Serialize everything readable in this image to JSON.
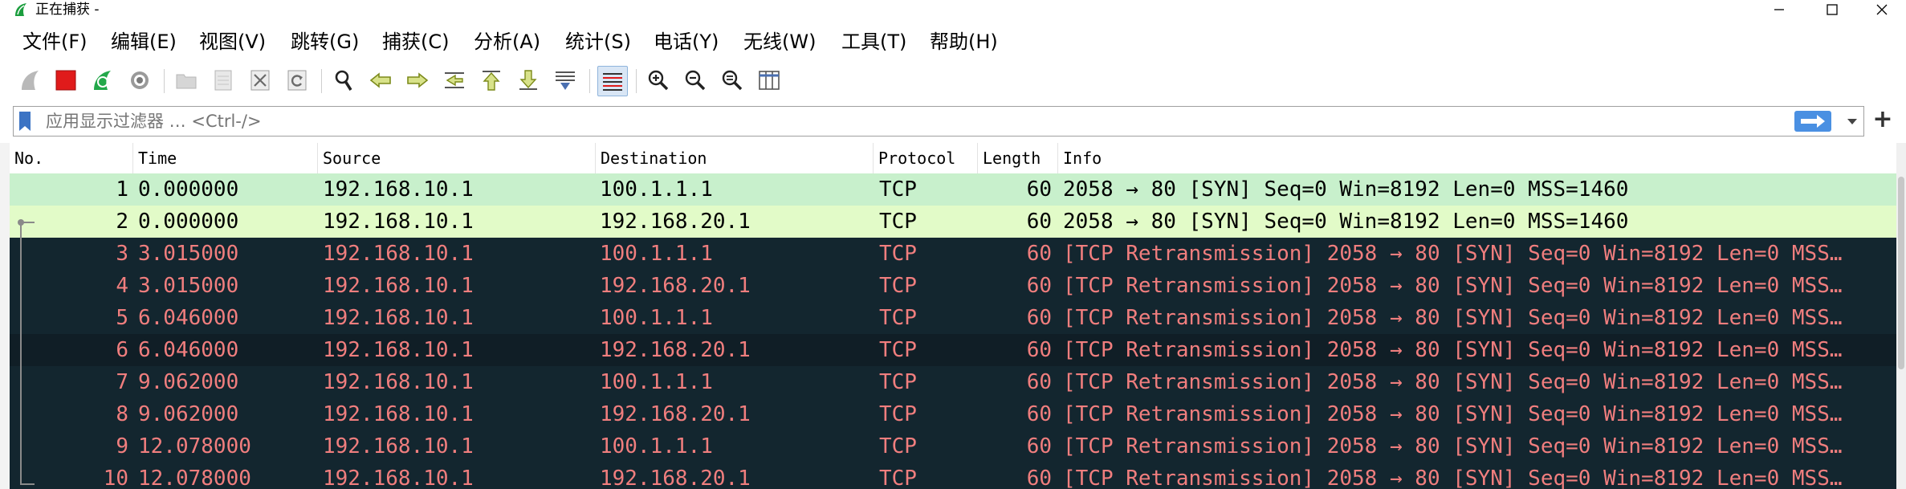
{
  "window": {
    "title": "正在捕获 -",
    "minimize_icon": "minimize-icon",
    "maximize_icon": "maximize-icon",
    "close_icon": "close-icon"
  },
  "menu": [
    {
      "label": "文件(F)"
    },
    {
      "label": "编辑(E)"
    },
    {
      "label": "视图(V)"
    },
    {
      "label": "跳转(G)"
    },
    {
      "label": "捕获(C)"
    },
    {
      "label": "分析(A)"
    },
    {
      "label": "统计(S)"
    },
    {
      "label": "电话(Y)"
    },
    {
      "label": "无线(W)"
    },
    {
      "label": "工具(T)"
    },
    {
      "label": "帮助(H)"
    }
  ],
  "toolbar": {
    "icons": [
      "start-capture-icon",
      "stop-capture-icon",
      "restart-capture-icon",
      "capture-options-icon",
      "open-file-icon",
      "save-file-icon",
      "close-file-icon",
      "reload-file-icon",
      "find-packet-icon",
      "go-back-icon",
      "go-forward-icon",
      "go-to-packet-icon",
      "first-packet-icon",
      "last-packet-icon",
      "auto-scroll-icon",
      "colorize-icon",
      "zoom-in-icon",
      "zoom-out-icon",
      "normal-size-icon",
      "resize-columns-icon"
    ]
  },
  "filter": {
    "placeholder": "应用显示过滤器 … <Ctrl-/>",
    "value": ""
  },
  "colors": {
    "row_green": "#c8f0cc",
    "row_light_green": "#e2fbc8",
    "row_dark": "#13262f",
    "row_dark_alt": "#101e26",
    "text_red": "#f07e7e",
    "accent_blue": "#4a90e2",
    "stop_red": "#e01b1b"
  },
  "packet_list": {
    "columns": [
      "No.",
      "Time",
      "Source",
      "Destination",
      "Protocol",
      "Length",
      "Info"
    ],
    "rows": [
      {
        "no": "1",
        "time": "0.000000",
        "source": "192.168.10.1",
        "destination": "100.1.1.1",
        "protocol": "TCP",
        "length": "60",
        "info": "2058 → 80 [SYN] Seq=0 Win=8192 Len=0 MSS=1460",
        "style": "green"
      },
      {
        "no": "2",
        "time": "0.000000",
        "source": "192.168.10.1",
        "destination": "192.168.20.1",
        "protocol": "TCP",
        "length": "60",
        "info": "2058 → 80 [SYN] Seq=0 Win=8192 Len=0 MSS=1460",
        "style": "light"
      },
      {
        "no": "3",
        "time": "3.015000",
        "source": "192.168.10.1",
        "destination": "100.1.1.1",
        "protocol": "TCP",
        "length": "60",
        "info": "[TCP Retransmission] 2058 → 80 [SYN] Seq=0 Win=8192 Len=0 MSS…",
        "style": "dark"
      },
      {
        "no": "4",
        "time": "3.015000",
        "source": "192.168.10.1",
        "destination": "192.168.20.1",
        "protocol": "TCP",
        "length": "60",
        "info": "[TCP Retransmission] 2058 → 80 [SYN] Seq=0 Win=8192 Len=0 MSS…",
        "style": "dark"
      },
      {
        "no": "5",
        "time": "6.046000",
        "source": "192.168.10.1",
        "destination": "100.1.1.1",
        "protocol": "TCP",
        "length": "60",
        "info": "[TCP Retransmission] 2058 → 80 [SYN] Seq=0 Win=8192 Len=0 MSS…",
        "style": "dark"
      },
      {
        "no": "6",
        "time": "6.046000",
        "source": "192.168.10.1",
        "destination": "192.168.20.1",
        "protocol": "TCP",
        "length": "60",
        "info": "[TCP Retransmission] 2058 → 80 [SYN] Seq=0 Win=8192 Len=0 MSS…",
        "style": "dark-alt"
      },
      {
        "no": "7",
        "time": "9.062000",
        "source": "192.168.10.1",
        "destination": "100.1.1.1",
        "protocol": "TCP",
        "length": "60",
        "info": "[TCP Retransmission] 2058 → 80 [SYN] Seq=0 Win=8192 Len=0 MSS…",
        "style": "dark"
      },
      {
        "no": "8",
        "time": "9.062000",
        "source": "192.168.10.1",
        "destination": "192.168.20.1",
        "protocol": "TCP",
        "length": "60",
        "info": "[TCP Retransmission] 2058 → 80 [SYN] Seq=0 Win=8192 Len=0 MSS…",
        "style": "dark"
      },
      {
        "no": "9",
        "time": "12.078000",
        "source": "192.168.10.1",
        "destination": "100.1.1.1",
        "protocol": "TCP",
        "length": "60",
        "info": "[TCP Retransmission] 2058 → 80 [SYN] Seq=0 Win=8192 Len=0 MSS…",
        "style": "dark"
      },
      {
        "no": "10",
        "time": "12.078000",
        "source": "192.168.10.1",
        "destination": "192.168.20.1",
        "protocol": "TCP",
        "length": "60",
        "info": "[TCP Retransmission] 2058 → 80 [SYN] Seq=0 Win=8192 Len=0 MSS…",
        "style": "dark"
      }
    ]
  }
}
